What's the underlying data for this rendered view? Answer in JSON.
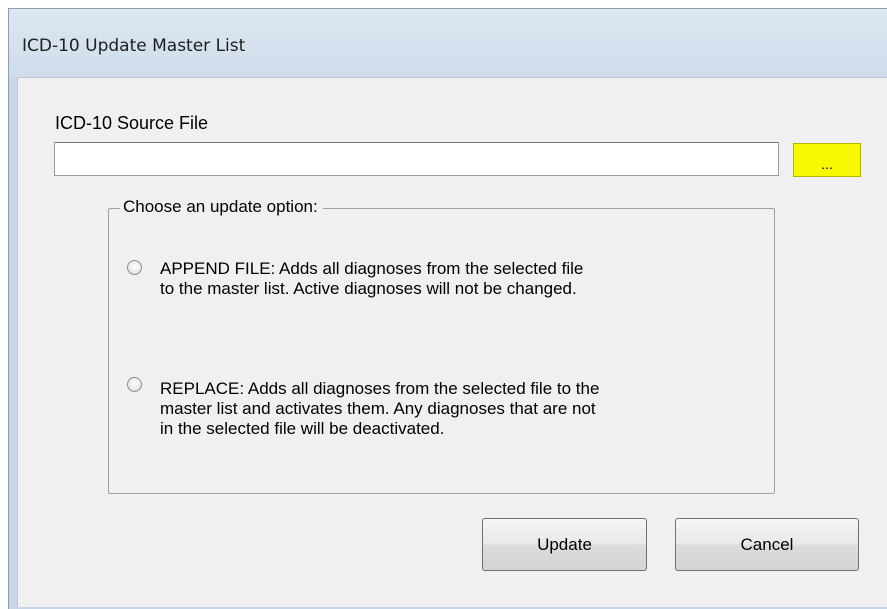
{
  "window": {
    "title": "ICD-10 Update Master List"
  },
  "source": {
    "label": "ICD-10 Source File",
    "value": "",
    "placeholder": "",
    "browse_label": "..."
  },
  "options_group": {
    "legend": "Choose an update option:",
    "options": [
      {
        "id": "append",
        "line1": "APPEND FILE: Adds all diagnoses from the selected file",
        "line2": "to the master list. Active diagnoses will not be changed.",
        "line3": "",
        "selected": false
      },
      {
        "id": "replace",
        "line1": "REPLACE: Adds all diagnoses from the selected file to the",
        "line2": "master list and activates them. Any diagnoses that are not",
        "line3": "in the selected file will be deactivated.",
        "selected": false
      }
    ]
  },
  "buttons": {
    "update_label": "Update",
    "cancel_label": "Cancel"
  },
  "colors": {
    "browse_button_bg": "#f8f800",
    "window_frame": "#c7d6e8",
    "client_bg": "#f0f0f0"
  }
}
